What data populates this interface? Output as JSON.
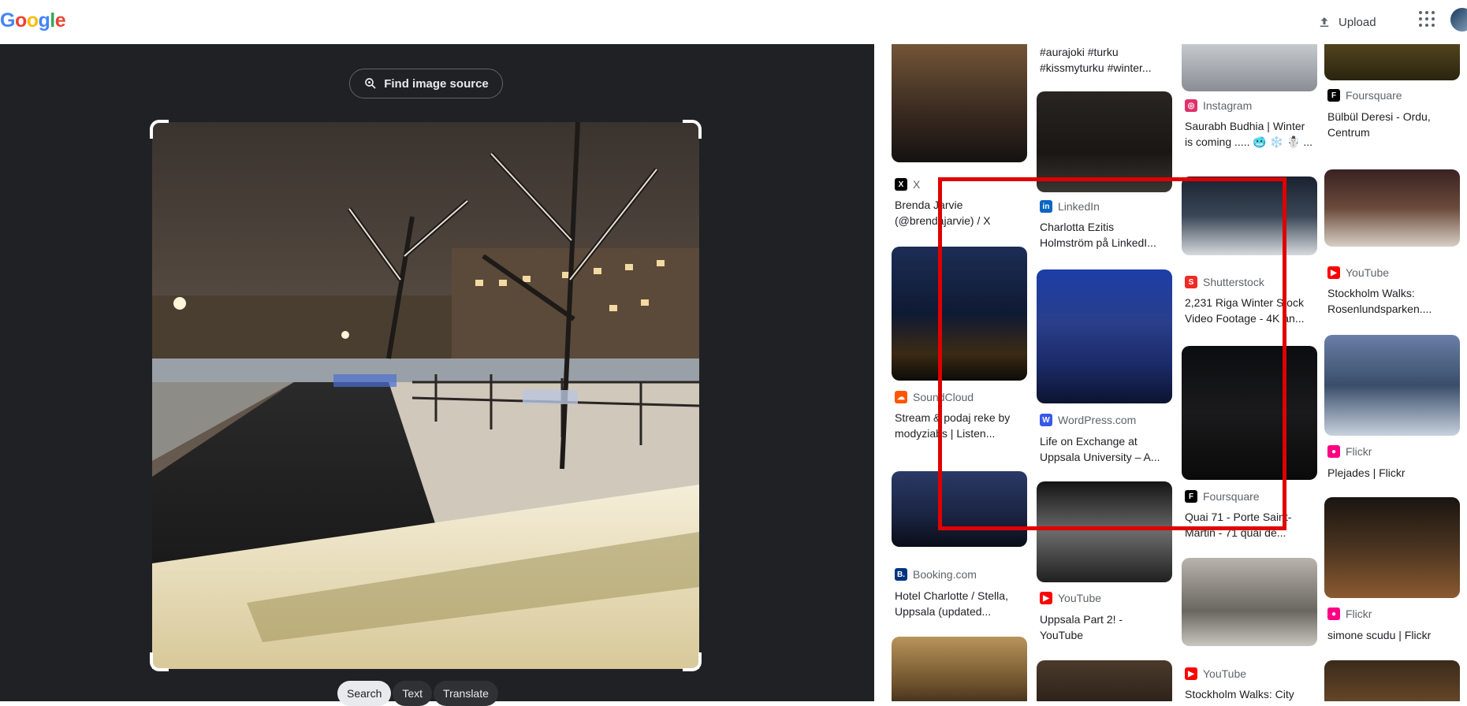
{
  "header": {
    "logo_letters": [
      "G",
      "o",
      "o",
      "g",
      "l",
      "e"
    ],
    "upload_label": "Upload",
    "upload_icon": "upload-icon",
    "apps_icon": "apps-grid-icon"
  },
  "viewer": {
    "find_source_label": "Find image source",
    "modes": [
      "Search",
      "Text",
      "Translate"
    ],
    "active_mode": "Search"
  },
  "results": {
    "col1": [
      {
        "source": "X",
        "title_lines": [
          "Brenda Jarvie",
          "(@brendajarvie) / X"
        ],
        "favicon_color": "#000000"
      },
      {
        "source": "SoundCloud",
        "title_lines": [
          "Stream & podaj reke by",
          "modyziabs | Listen..."
        ],
        "favicon_color": "#ff5500"
      },
      {
        "source": "Booking.com",
        "title_lines": [
          "Hotel Charlotte / Stella,",
          "Uppsala (updated..."
        ],
        "favicon_color": "#003580"
      }
    ],
    "col2": [
      {
        "source": "",
        "title_lines": [
          "#aurajoki #turku",
          "#kissmyturku #winter..."
        ],
        "favicon_color": ""
      },
      {
        "source": "LinkedIn",
        "title_lines": [
          "Charlotta Ezitis",
          "Holmström på LinkedI..."
        ],
        "favicon_color": "#0a66c2"
      },
      {
        "source": "WordPress.com",
        "title_lines": [
          "Life on Exchange at",
          "Uppsala University – A..."
        ],
        "favicon_color": "#3858e9"
      },
      {
        "source": "YouTube",
        "title_lines": [
          "Uppsala Part 2! -",
          "YouTube"
        ],
        "favicon_color": "#ff0000"
      }
    ],
    "col3": [
      {
        "source": "Instagram",
        "title_lines": [
          "Saurabh Budhia | Winter",
          "is coming ..... 🥶 ❄️ ☃️ ..."
        ],
        "favicon_color": "#e1306c"
      },
      {
        "source": "Shutterstock",
        "title_lines": [
          "2,231 Riga Winter Stock",
          "Video Footage - 4K an..."
        ],
        "favicon_color": "#ee2b24"
      },
      {
        "source": "Foursquare",
        "title_lines": [
          "Quai 71 - Porte Saint-",
          "Martin - 71 quai de..."
        ],
        "favicon_color": "#000000"
      },
      {
        "source": "YouTube",
        "title_lines": [
          "Stockholm Walks: City"
        ],
        "favicon_color": "#ff0000"
      }
    ],
    "col4": [
      {
        "source": "Foursquare",
        "title_lines": [
          "Bülbül Deresi - Ordu,",
          "Centrum"
        ],
        "favicon_color": "#000000"
      },
      {
        "source": "YouTube",
        "title_lines": [
          "Stockholm Walks:",
          "Rosenlundsparken...."
        ],
        "favicon_color": "#ff0000"
      },
      {
        "source": "Flickr",
        "title_lines": [
          "Plejades | Flickr"
        ],
        "favicon_color": "#ff0084"
      },
      {
        "source": "Flickr",
        "title_lines": [
          "simone scudu | Flickr"
        ],
        "favicon_color": "#ff0084"
      }
    ]
  },
  "annotation": {
    "color": "#e00000"
  }
}
